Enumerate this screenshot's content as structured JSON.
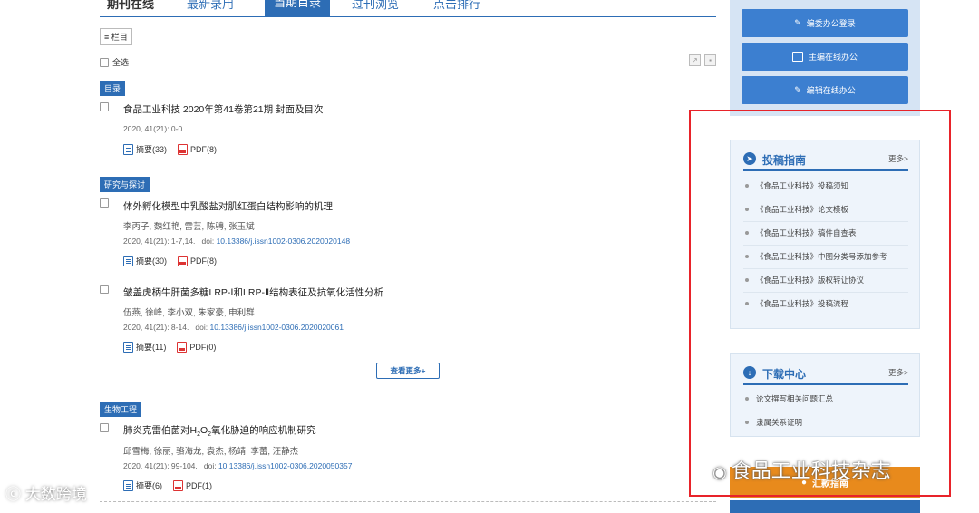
{
  "tabs": [
    "期刊在线",
    "最新录用",
    "当期目录",
    "过刊浏览",
    "点击排行"
  ],
  "toolbar": {
    "columns_label": "≡ 栏目",
    "select_all": "全选"
  },
  "sections": {
    "s1": "目录",
    "s2": "研究与探讨",
    "s3": "生物工程"
  },
  "articles": [
    {
      "title": "食品工业科技 2020年第41卷第21期 封面及目次",
      "meta": "2020, 41(21): 0-0.",
      "abstract": "摘要(33)",
      "pdf": "PDF(8)"
    },
    {
      "title": "体外孵化模型中乳酸盐对肌红蛋白结构影响的机理",
      "authors": "李丙子, 魏红艳, 雷芸, 陈骋, 张玉斌",
      "meta": "2020, 41(21): 1-7,14.",
      "doi_label": "doi:",
      "doi": "10.13386/j.issn1002-0306.2020020148",
      "abstract": "摘要(30)",
      "pdf": "PDF(8)"
    },
    {
      "title": "皱盖虎柄牛肝菌多糖LRP-Ⅰ和LRP-Ⅱ结构表征及抗氧化活性分析",
      "authors": "伍燕, 徐峰, 李小双, 朱家豪, 申利群",
      "meta": "2020, 41(21): 8-14.",
      "doi_label": "doi:",
      "doi": "10.13386/j.issn1002-0306.2020020061",
      "abstract": "摘要(11)",
      "pdf": "PDF(0)"
    },
    {
      "title_a": "肺炎克雷伯菌对H",
      "title_sub1": "2",
      "title_b": "O",
      "title_sub2": "2",
      "title_c": "氧化胁迫的响应机制研究",
      "authors": "邱雪梅, 徐丽, 骆海龙, 袁杰, 杨靖, 李蕾, 汪静杰",
      "meta": "2020, 41(21): 99-104.",
      "doi_label": "doi:",
      "doi": "10.13386/j.issn1002-0306.2020050357",
      "abstract": "摘要(6)",
      "pdf": "PDF(1)"
    }
  ],
  "more_button": "查看更多+",
  "office_buttons": [
    "编委办公登录",
    "主编在线办公",
    "编辑在线办公"
  ],
  "guide": {
    "title": "投稿指南",
    "more": "更多>",
    "items": [
      "《食品工业科技》投稿须知",
      "《食品工业科技》论文模板",
      "《食品工业科技》稿件自查表",
      "《食品工业科技》中图分类号添加参考",
      "《食品工业科技》版权转让协议",
      "《食品工业科技》投稿流程"
    ]
  },
  "download": {
    "title": "下载中心",
    "more": "更多>",
    "items": [
      "论文撰写相关问题汇总",
      "隶属关系证明"
    ]
  },
  "orange_button": "汇款指南",
  "watermarks": {
    "right": "食品工业科技杂志",
    "left": "大数跨境"
  },
  "colors": {
    "accent": "#2d6db5",
    "highlight_box": "#e8232a",
    "orange": "#e88a1c"
  }
}
